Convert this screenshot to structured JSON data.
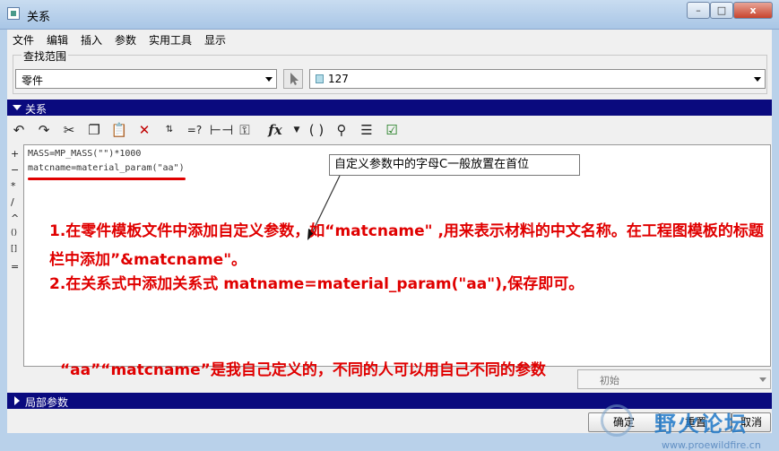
{
  "window": {
    "title": "关系",
    "controls": {
      "minimize": "–",
      "maximize": "□",
      "close": "x"
    }
  },
  "menu": [
    "文件",
    "编辑",
    "插入",
    "参数",
    "实用工具",
    "显示"
  ],
  "scope": {
    "label": "查找范围",
    "type_value": "零件",
    "part_value": "127"
  },
  "relations_section": {
    "label": "关系"
  },
  "toolbar": {
    "buttons": [
      "undo",
      "redo",
      "cut",
      "copy",
      "paste",
      "delete",
      "sort",
      "evaluate",
      "dimension",
      "relation-check",
      "function",
      "parentheses",
      "verify",
      "relation-list",
      "checkbox"
    ]
  },
  "side_ops": [
    "+",
    "−",
    "*",
    "/",
    "^",
    "()",
    "[]",
    "="
  ],
  "editor": {
    "lines": [
      "MASS=MP_MASS(\"\")*1000",
      "matcname=material_param(\"aa\")"
    ],
    "callout": "自定义参数中的字母C一般放置在首位",
    "note1": "1.在零件模板文件中添加自定义参数，如“matcname\" ,用来表示材料的中文名称。在工程图模板的标题栏中添加”&matcname\"。",
    "note2": "2.在关系式中添加关系式 matname=material_param(\"aa\"),保存即可。",
    "note3": "“aa”“matcname”是我自己定义的，不同的人可以用自己不同的参数"
  },
  "units_combo": {
    "value": "初始"
  },
  "local_params": {
    "label": "局部参数"
  },
  "buttons": {
    "ok": "确定",
    "reset": "重置",
    "cancel": "取消"
  },
  "watermark": {
    "text": "野火论坛",
    "url": "www.proewildfire.cn"
  }
}
